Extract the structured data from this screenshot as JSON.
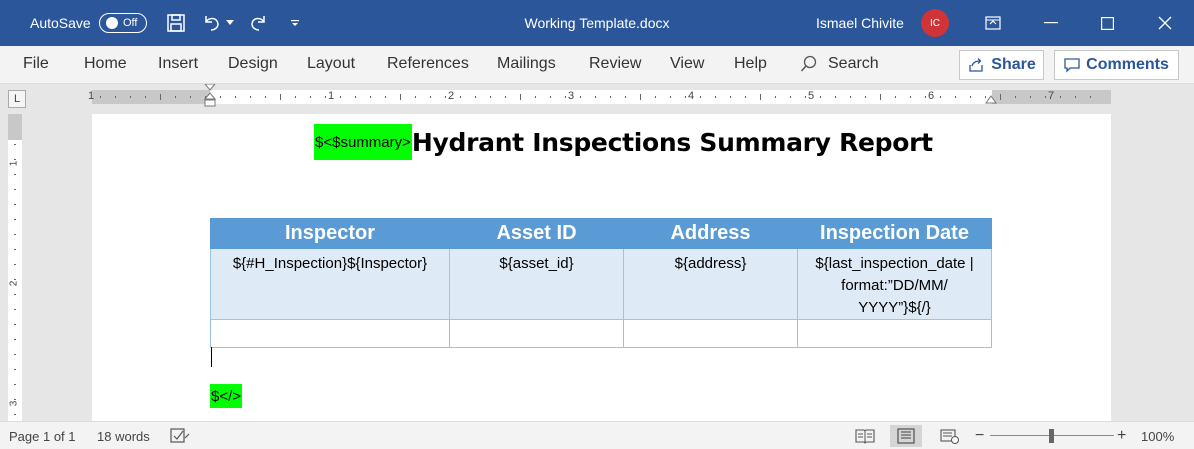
{
  "titlebar": {
    "autosave_label": "AutoSave",
    "autosave_state": "Off",
    "document_title": "Working Template.docx",
    "user_name": "Ismael Chivite",
    "user_initials": "IC",
    "avatar_color": "#d13438",
    "bar_color": "#2b579a"
  },
  "ribbon": {
    "tabs": [
      "File",
      "Home",
      "Insert",
      "Design",
      "Layout",
      "References",
      "Mailings",
      "Review",
      "View",
      "Help"
    ],
    "search_label": "Search",
    "share_label": "Share",
    "comments_label": "Comments"
  },
  "ruler": {
    "corner_glyph": "L",
    "h_labels": [
      "1",
      "1",
      "2",
      "3",
      "4",
      "5",
      "6",
      "7"
    ],
    "v_labels": [
      "1",
      "2",
      "3"
    ]
  },
  "document": {
    "summary_placeholder": "$<$summary>",
    "title": "Hydrant Inspections Summary Report",
    "table": {
      "headers": [
        "Inspector",
        "Asset ID",
        "Address",
        "Inspection Date"
      ],
      "row": [
        "${#H_Inspection}${Inspector}",
        "${asset_id}",
        "${address}",
        "${last_inspection_date | format:”DD/MM/ YYYY”}${/}"
      ]
    },
    "end_placeholder": "$</>",
    "highlight_color": "#00ff00",
    "header_color": "#5b9bd5",
    "row_color": "#deeaf6"
  },
  "statusbar": {
    "page_info": "Page 1 of 1",
    "word_count": "18 words",
    "zoom_minus": "−",
    "zoom_plus": "+",
    "zoom_level": "100%"
  }
}
